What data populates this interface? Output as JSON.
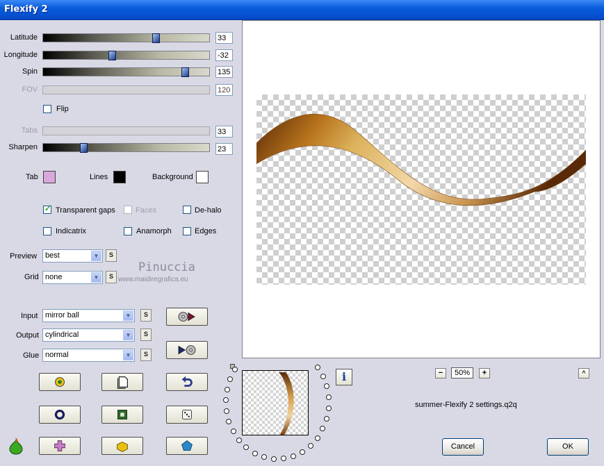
{
  "window": {
    "title": "Flexify 2"
  },
  "sliders": [
    {
      "label": "Latitude",
      "value": "33",
      "enabled": true
    },
    {
      "label": "Longitude",
      "value": "-32",
      "enabled": true
    },
    {
      "label": "Spin",
      "value": "135",
      "enabled": true
    },
    {
      "label": "FOV",
      "value": "120",
      "enabled": false
    },
    {
      "label": "Tabs",
      "value": "33",
      "enabled": false
    },
    {
      "label": "Sharpen",
      "value": "23",
      "enabled": true
    }
  ],
  "flip": {
    "label": "Flip",
    "checked": false
  },
  "colors": {
    "tab": {
      "label": "Tab",
      "color": "#d8a8dc"
    },
    "lines": {
      "label": "Lines",
      "color": "#000000"
    },
    "background": {
      "label": "Background",
      "color": "#ffffff"
    }
  },
  "options": [
    {
      "label": "Transparent gaps",
      "checked": true,
      "enabled": true
    },
    {
      "label": "Faces",
      "checked": false,
      "enabled": false
    },
    {
      "label": "De-halo",
      "checked": false,
      "enabled": true
    },
    {
      "label": "Indicatrix",
      "checked": false,
      "enabled": true
    },
    {
      "label": "Anamorph",
      "checked": false,
      "enabled": true
    },
    {
      "label": "Edges",
      "checked": false,
      "enabled": true
    }
  ],
  "preview_select": {
    "label": "Preview",
    "value": "best"
  },
  "grid_select": {
    "label": "Grid",
    "value": "none"
  },
  "input_select": {
    "label": "Input",
    "value": "mirror ball"
  },
  "output_select": {
    "label": "Output",
    "value": "cylindrical"
  },
  "glue_select": {
    "label": "Glue",
    "value": "normal"
  },
  "s_label": "S",
  "watermark": {
    "name": "Pinuccia",
    "url": "www.maidiregrafica.eu"
  },
  "zoom": {
    "value": "50%",
    "minus": "−",
    "plus": "+"
  },
  "settings_file": "summer-Flexify 2 settings.q2q",
  "buttons": {
    "cancel": "Cancel",
    "ok": "OK",
    "info": "i",
    "up": "^"
  }
}
